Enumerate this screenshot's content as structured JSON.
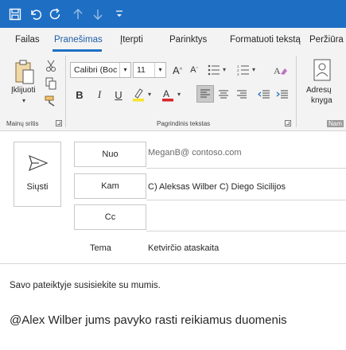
{
  "quick_access": {
    "save_icon": "save-icon",
    "undo_icon": "undo-icon",
    "redo_icon": "redo-icon",
    "up_icon": "arrow-up-icon",
    "down_icon": "arrow-down-icon",
    "customize_icon": "customize-toolbar-icon"
  },
  "tabs": [
    "Failas",
    "Pranešimas",
    "Įterpti",
    "Parinktys",
    "Formatuoti tekstą",
    "Peržiūra"
  ],
  "active_tab": "Pranešimas",
  "ribbon": {
    "clipboard": {
      "paste_label": "Įklijuoti",
      "group_label": "Mainų sritis"
    },
    "basic_text": {
      "font_name": "Calibri (Boc",
      "font_size": "11",
      "bold": "B",
      "italic": "I",
      "underline": "U",
      "group_label": "Pagrindinis tekstas"
    },
    "names": {
      "address_book_line1": "Adresų",
      "address_book_line2": "knyga",
      "group_label": "Nam"
    },
    "highlight_color": "#f6e52a",
    "font_color": "#d9252a"
  },
  "message": {
    "send_label": "Siųsti",
    "from_label": "Nuo",
    "from_value": "MeganB@ contoso.com",
    "to_label": "Kam",
    "to_value": "C) Aleksas Wilber C) Diego Sicilijos",
    "cc_label": "Cc",
    "subject_label": "Tema",
    "subject_value": "Ketvirčio ataskaita",
    "body_line1": "Savo pateiktyje susisiekite su mumis.",
    "body_line2": "@Alex Wilber jums pavyko rasti reikiamus duomenis"
  },
  "colors": {
    "titlebar": "#1e6fc4",
    "accent": "#1e5da8"
  }
}
